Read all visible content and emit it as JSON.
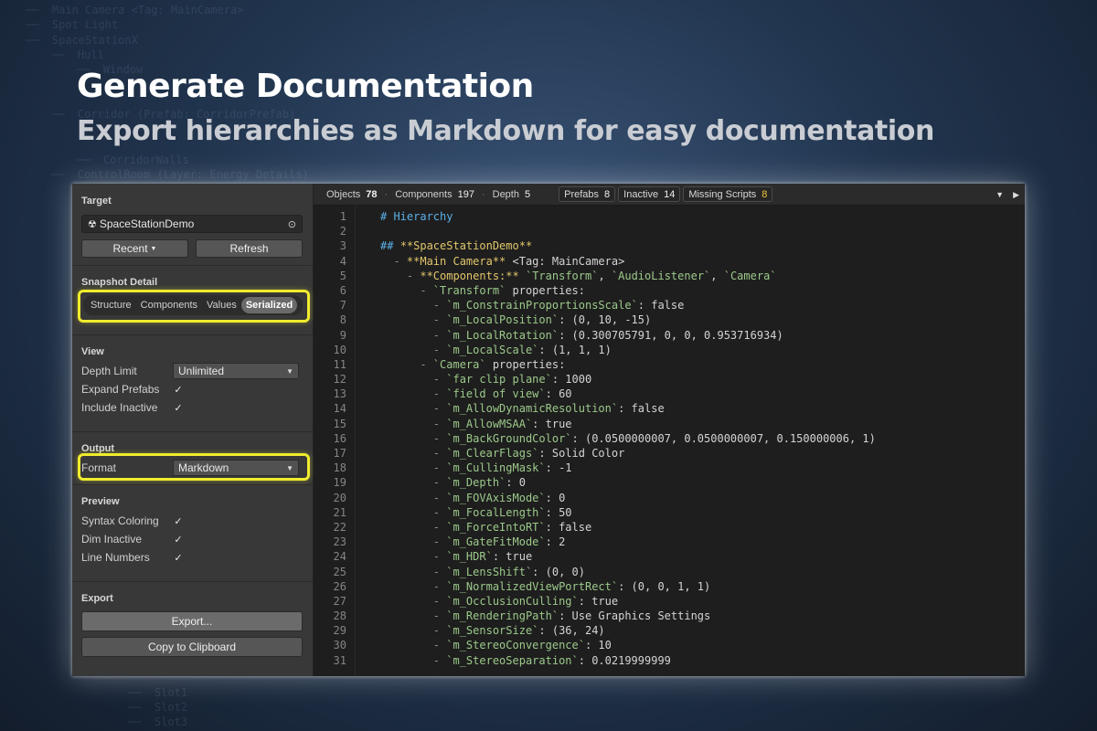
{
  "background_tree": [
    "Main Camera <Tag: MainCamera>",
    "Spot Light",
    "SpaceStationX",
    "Hull",
    "Window",
    "Corridor (Prefab: CorridorPrefab)",
    "CorridorWalls",
    "ControlRoom (Layer: Energy Details)",
    "Slot1",
    "Slot2",
    "Slot3"
  ],
  "hero": {
    "title": "Generate Documentation",
    "subtitle": "Export hierarchies as Markdown for easy documentation"
  },
  "panel": {
    "target": {
      "title": "Target",
      "object_name": "SpaceStationDemo",
      "recent_label": "Recent",
      "refresh_label": "Refresh"
    },
    "snapshot": {
      "title": "Snapshot Detail",
      "options": [
        "Structure",
        "Components",
        "Values",
        "Serialized"
      ],
      "selected": "Serialized"
    },
    "view": {
      "title": "View",
      "depth_limit_label": "Depth Limit",
      "depth_limit_value": "Unlimited",
      "expand_prefabs_label": "Expand Prefabs",
      "include_inactive_label": "Include Inactive"
    },
    "output": {
      "title": "Output",
      "format_label": "Format",
      "format_value": "Markdown"
    },
    "preview": {
      "title": "Preview",
      "syntax_coloring_label": "Syntax Coloring",
      "dim_inactive_label": "Dim Inactive",
      "line_numbers_label": "Line Numbers"
    },
    "export": {
      "title": "Export",
      "export_label": "Export...",
      "clipboard_label": "Copy to Clipboard"
    },
    "check_glyph": "✓"
  },
  "toolbar": {
    "objects_label": "Objects",
    "objects_value": "78",
    "components_label": "Components",
    "components_value": "197",
    "depth_label": "Depth",
    "depth_value": "5",
    "chips": [
      {
        "label": "Prefabs",
        "value": "8",
        "warn": false
      },
      {
        "label": "Inactive",
        "value": "14",
        "warn": false
      },
      {
        "label": "Missing Scripts",
        "value": "8",
        "warn": true
      }
    ]
  },
  "code_lines": [
    [
      [
        "h",
        "# Hierarchy"
      ]
    ],
    [],
    [
      [
        "h",
        "## "
      ],
      [
        "b",
        "**SpaceStationDemo**"
      ]
    ],
    [
      [
        "m",
        "  - "
      ],
      [
        "b",
        "**Main Camera**"
      ],
      [
        "t",
        " <Tag: MainCamera>"
      ]
    ],
    [
      [
        "m",
        "    - "
      ],
      [
        "b",
        "**Components:**"
      ],
      [
        "t",
        " "
      ],
      [
        "s",
        "`Transform`"
      ],
      [
        "t",
        ", "
      ],
      [
        "s",
        "`AudioListener`"
      ],
      [
        "t",
        ", "
      ],
      [
        "s",
        "`Camera`"
      ]
    ],
    [
      [
        "m",
        "      - "
      ],
      [
        "s",
        "`Transform`"
      ],
      [
        "t",
        " properties:"
      ]
    ],
    [
      [
        "m",
        "        - "
      ],
      [
        "s",
        "`m_ConstrainProportionsScale`"
      ],
      [
        "t",
        ": false"
      ]
    ],
    [
      [
        "m",
        "        - "
      ],
      [
        "s",
        "`m_LocalPosition`"
      ],
      [
        "t",
        ": (0, 10, -15)"
      ]
    ],
    [
      [
        "m",
        "        - "
      ],
      [
        "s",
        "`m_LocalRotation`"
      ],
      [
        "t",
        ": (0.300705791, 0, 0, 0.953716934)"
      ]
    ],
    [
      [
        "m",
        "        - "
      ],
      [
        "s",
        "`m_LocalScale`"
      ],
      [
        "t",
        ": (1, 1, 1)"
      ]
    ],
    [
      [
        "m",
        "      - "
      ],
      [
        "s",
        "`Camera`"
      ],
      [
        "t",
        " properties:"
      ]
    ],
    [
      [
        "m",
        "        - "
      ],
      [
        "s",
        "`far clip plane`"
      ],
      [
        "t",
        ": 1000"
      ]
    ],
    [
      [
        "m",
        "        - "
      ],
      [
        "s",
        "`field of view`"
      ],
      [
        "t",
        ": 60"
      ]
    ],
    [
      [
        "m",
        "        - "
      ],
      [
        "s",
        "`m_AllowDynamicResolution`"
      ],
      [
        "t",
        ": false"
      ]
    ],
    [
      [
        "m",
        "        - "
      ],
      [
        "s",
        "`m_AllowMSAA`"
      ],
      [
        "t",
        ": true"
      ]
    ],
    [
      [
        "m",
        "        - "
      ],
      [
        "s",
        "`m_BackGroundColor`"
      ],
      [
        "t",
        ": (0.0500000007, 0.0500000007, 0.150000006, 1)"
      ]
    ],
    [
      [
        "m",
        "        - "
      ],
      [
        "s",
        "`m_ClearFlags`"
      ],
      [
        "t",
        ": Solid Color"
      ]
    ],
    [
      [
        "m",
        "        - "
      ],
      [
        "s",
        "`m_CullingMask`"
      ],
      [
        "t",
        ": -1"
      ]
    ],
    [
      [
        "m",
        "        - "
      ],
      [
        "s",
        "`m_Depth`"
      ],
      [
        "t",
        ": 0"
      ]
    ],
    [
      [
        "m",
        "        - "
      ],
      [
        "s",
        "`m_FOVAxisMode`"
      ],
      [
        "t",
        ": 0"
      ]
    ],
    [
      [
        "m",
        "        - "
      ],
      [
        "s",
        "`m_FocalLength`"
      ],
      [
        "t",
        ": 50"
      ]
    ],
    [
      [
        "m",
        "        - "
      ],
      [
        "s",
        "`m_ForceIntoRT`"
      ],
      [
        "t",
        ": false"
      ]
    ],
    [
      [
        "m",
        "        - "
      ],
      [
        "s",
        "`m_GateFitMode`"
      ],
      [
        "t",
        ": 2"
      ]
    ],
    [
      [
        "m",
        "        - "
      ],
      [
        "s",
        "`m_HDR`"
      ],
      [
        "t",
        ": true"
      ]
    ],
    [
      [
        "m",
        "        - "
      ],
      [
        "s",
        "`m_LensShift`"
      ],
      [
        "t",
        ": (0, 0)"
      ]
    ],
    [
      [
        "m",
        "        - "
      ],
      [
        "s",
        "`m_NormalizedViewPortRect`"
      ],
      [
        "t",
        ": (0, 0, 1, 1)"
      ]
    ],
    [
      [
        "m",
        "        - "
      ],
      [
        "s",
        "`m_OcclusionCulling`"
      ],
      [
        "t",
        ": true"
      ]
    ],
    [
      [
        "m",
        "        - "
      ],
      [
        "s",
        "`m_RenderingPath`"
      ],
      [
        "t",
        ": Use Graphics Settings"
      ]
    ],
    [
      [
        "m",
        "        - "
      ],
      [
        "s",
        "`m_SensorSize`"
      ],
      [
        "t",
        ": (36, 24)"
      ]
    ],
    [
      [
        "m",
        "        - "
      ],
      [
        "s",
        "`m_StereoConvergence`"
      ],
      [
        "t",
        ": 10"
      ]
    ],
    [
      [
        "m",
        "        - "
      ],
      [
        "s",
        "`m_StereoSeparation`"
      ],
      [
        "t",
        ": 0.0219999999"
      ]
    ]
  ],
  "colors": {
    "highlight": "#f0ec2e",
    "heading": "#5bb0e8",
    "bold": "#e2c66b",
    "inline_code": "#9cc98a",
    "warning": "#f0c23a"
  }
}
